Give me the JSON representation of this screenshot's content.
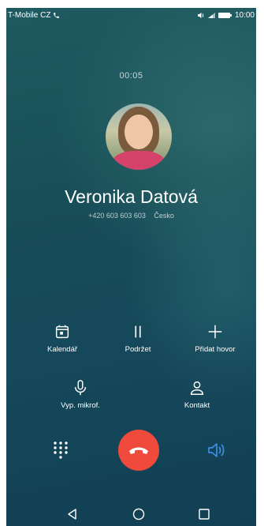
{
  "status_bar": {
    "carrier": "T-Mobile CZ",
    "time": "10:00"
  },
  "call": {
    "duration": "00:05",
    "name": "Veronika Datová",
    "number": "+420 603 603 603",
    "location": "Česko"
  },
  "actions": {
    "calendar": "Kalendář",
    "hold": "Podržet",
    "add_call": "Přidat hovor",
    "mute": "Vyp. mikrof.",
    "contact": "Kontakt"
  },
  "colors": {
    "end_call": "#f04a3d",
    "speaker_active": "#3d8fe6"
  },
  "icons": [
    "phone-icon",
    "volte-icon",
    "signal-icon",
    "battery-icon",
    "calendar-icon",
    "pause-icon",
    "plus-icon",
    "microphone-icon",
    "person-icon",
    "dialpad-icon",
    "end-call-icon",
    "speaker-icon",
    "back-icon",
    "home-icon",
    "recents-icon"
  ]
}
